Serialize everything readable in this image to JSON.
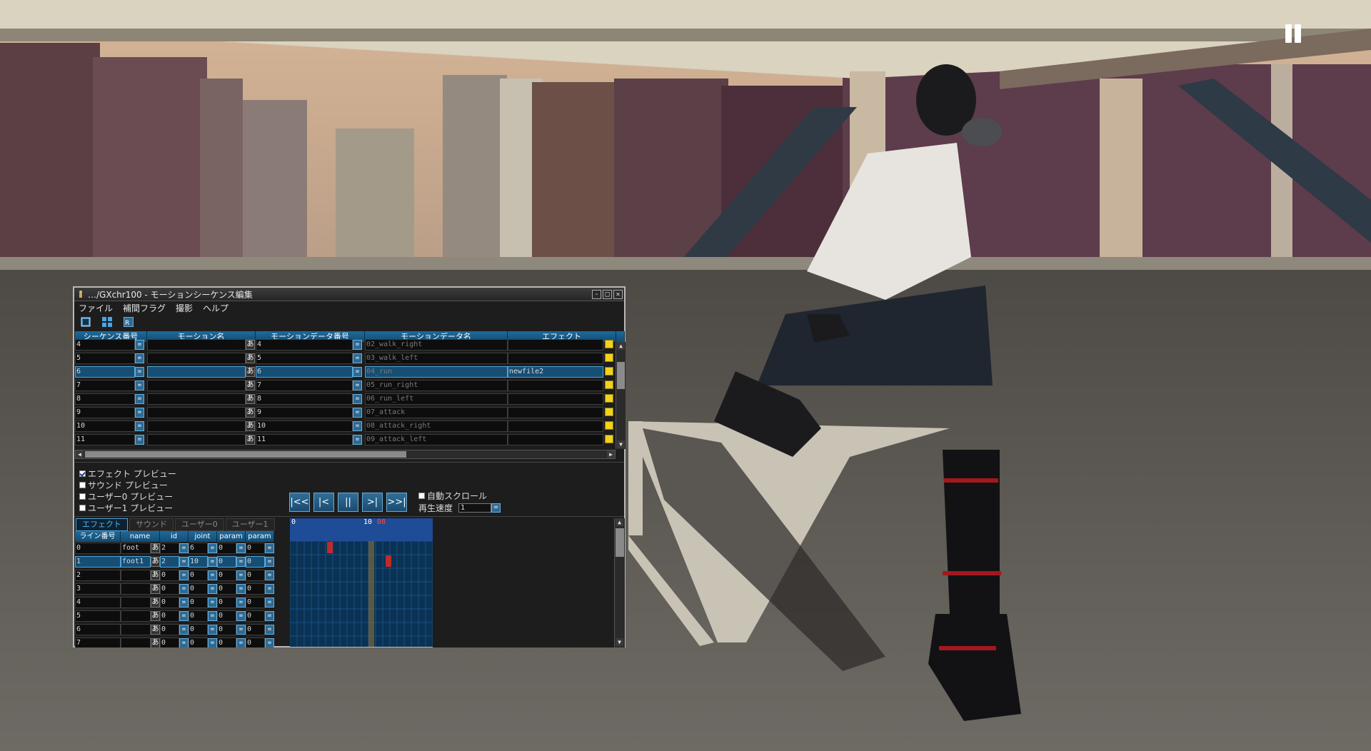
{
  "scene": {
    "description_colors": {
      "sky": "#c8a98c",
      "ground": "#5e5a55"
    }
  },
  "pause_button": {
    "icon": "pause-icon"
  },
  "window": {
    "title": "…/GXchr100 - モーションシーケンス編集",
    "buttons": {
      "minimize": "-",
      "maximize": "□",
      "close": "✕"
    }
  },
  "menu": [
    "ファイル",
    "補間フラグ",
    "撮影",
    "ヘルプ"
  ],
  "toolbar_icons": [
    "window-icon",
    "grid-icon",
    "camera-icon"
  ],
  "grid": {
    "headers": [
      "シーケンス番号",
      "モーション名",
      "モーションデータ番号",
      "モーションデータ名",
      "エフェクト"
    ],
    "rows": [
      {
        "seq": "4",
        "mname": "",
        "mnum": "4",
        "mdata": "02_walk_right",
        "effect": "",
        "selected": false
      },
      {
        "seq": "5",
        "mname": "",
        "mnum": "5",
        "mdata": "03_walk_left",
        "effect": "",
        "selected": false
      },
      {
        "seq": "6",
        "mname": "",
        "mnum": "6",
        "mdata": "04_run",
        "effect": "newfile2",
        "selected": true
      },
      {
        "seq": "7",
        "mname": "",
        "mnum": "7",
        "mdata": "05_run_right",
        "effect": "",
        "selected": false
      },
      {
        "seq": "8",
        "mname": "",
        "mnum": "8",
        "mdata": "06_run_left",
        "effect": "",
        "selected": false
      },
      {
        "seq": "9",
        "mname": "",
        "mnum": "9",
        "mdata": "07_attack",
        "effect": "",
        "selected": false
      },
      {
        "seq": "10",
        "mname": "",
        "mnum": "10",
        "mdata": "08_attack_right",
        "effect": "",
        "selected": false
      },
      {
        "seq": "11",
        "mname": "",
        "mnum": "11",
        "mdata": "09_attack_left",
        "effect": "",
        "selected": false
      }
    ],
    "btn_eq": "=",
    "btn_a": "あ"
  },
  "checks": [
    {
      "label": "エフェクト プレビュー",
      "checked": true
    },
    {
      "label": "サウンド プレビュー",
      "checked": false
    },
    {
      "label": "ユーザー0 プレビュー",
      "checked": false
    },
    {
      "label": "ユーザー1 プレビュー",
      "checked": false
    }
  ],
  "transport": [
    "|<<",
    "|<",
    "||",
    ">|",
    ">>|"
  ],
  "autoscroll": {
    "label": "自動スクロール",
    "checked": false
  },
  "speed": {
    "label": "再生速度",
    "value": "1"
  },
  "tabs": [
    "エフェクト",
    "サウンド",
    "ユーザー0",
    "ユーザー1"
  ],
  "lower_grid": {
    "headers": [
      "ライン番号",
      "name",
      "id",
      "joint",
      "param",
      "param"
    ],
    "rows": [
      {
        "line": "0",
        "name": "foot",
        "id": "2",
        "joint": "6",
        "p1": "0",
        "p2": "0",
        "selected": false
      },
      {
        "line": "1",
        "name": "foot1",
        "id": "2",
        "joint": "10",
        "p1": "0",
        "p2": "0",
        "selected": true
      },
      {
        "line": "2",
        "name": "",
        "id": "0",
        "joint": "0",
        "p1": "0",
        "p2": "0",
        "selected": false
      },
      {
        "line": "3",
        "name": "",
        "id": "0",
        "joint": "0",
        "p1": "0",
        "p2": "0",
        "selected": false
      },
      {
        "line": "4",
        "name": "",
        "id": "0",
        "joint": "0",
        "p1": "0",
        "p2": "0",
        "selected": false
      },
      {
        "line": "5",
        "name": "",
        "id": "0",
        "joint": "0",
        "p1": "0",
        "p2": "0",
        "selected": false
      },
      {
        "line": "6",
        "name": "",
        "id": "0",
        "joint": "0",
        "p1": "0",
        "p2": "0",
        "selected": false
      },
      {
        "line": "7",
        "name": "",
        "id": "0",
        "joint": "0",
        "p1": "0",
        "p2": "0",
        "selected": false
      }
    ]
  },
  "timeline": {
    "start_label": "0",
    "mark_label": "10",
    "current_label": "08"
  }
}
